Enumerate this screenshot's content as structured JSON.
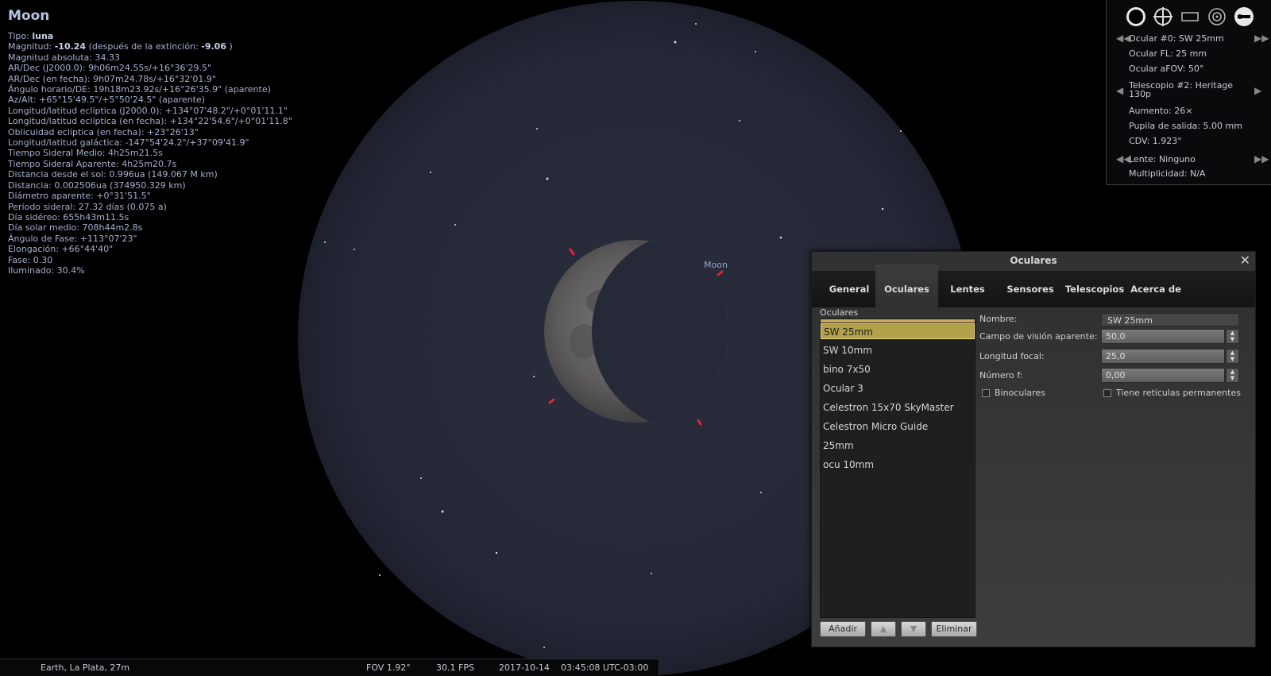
{
  "info": {
    "title": "Moon",
    "lines": {
      "tipo_label": "Tipo: ",
      "tipo_value": "luna",
      "mag_label": "Magnitud: ",
      "mag_value": "-10.24",
      "mag_mid": " (después de la extinción: ",
      "mag_ext": "-9.06",
      "mag_end": " )",
      "l1": "Magnitud absoluta: 34.33",
      "l2": "AR/Dec (J2000.0): 9h06m24.55s/+16°36'29.5\"",
      "l3": "AR/Dec (en fecha): 9h07m24.78s/+16°32'01.9\"",
      "l4": "Ángulo horario/DE: 19h18m23.92s/+16°26'35.9\" (aparente)",
      "l5": "Az/Alt: +65°15'49.5\"/+5°50'24.5\" (aparente)",
      "l6": "Longitud/latitud eclíptica (J2000.0): +134°07'48.2\"/+0°01'11.1\"",
      "l7": "Longitud/latitud eclíptica (en fecha): +134°22'54.6\"/+0°01'11.8\"",
      "l8": "Oblicuidad eclíptica (en fecha): +23°26'13\"",
      "l9": "Longitud/latitud galáctica: -147°54'24.2\"/+37°09'41.9\"",
      "l10": "Tiempo Sideral Medio: 4h25m21.5s",
      "l11": "Tiempo Sideral Aparente: 4h25m20.7s",
      "l12": "Distancia desde el sol: 0.996ua (149.067 M km)",
      "l13": "Distancia: 0.002506ua (374950.329 km)",
      "l14": "Diámetro aparente: +0°31'51.5\"",
      "l15": "Período sideral: 27.32 días (0.075 a)",
      "l16": "Día sidéreo: 655h43m11.5s",
      "l17": "Día solar medio: 708h44m2.8s",
      "l18": "Ángulo de Fase: +113°07'23\"",
      "l19": "Elongación: +66°44'40\"",
      "l20": "Fase: 0.30",
      "l21": "Iluminado: 30.4%"
    }
  },
  "sky": {
    "moon_label": "Moon"
  },
  "ocular_panel": {
    "ocular": "Ocular #0: SW 25mm",
    "ocular_fl": "Ocular FL: 25 mm",
    "ocular_afov": "Ocular aFOV: 50°",
    "telescope_line1": "Telescopio #2: Heritage",
    "telescope_line2": "130p",
    "aumento": "Aumento: 26×",
    "pupila": "Pupila de salida: 5.00 mm",
    "cdv": "CDV: 1.923°",
    "lente": "Lente: Ninguno",
    "multiplicidad": "Multiplicidad: N/A"
  },
  "bottombar": {
    "location": "Earth, La Plata, 27m",
    "fov": "FOV 1.92°",
    "fps": "30.1 FPS",
    "date": "2017-10-14",
    "time": "03:45:08 UTC-03:00"
  },
  "dialog": {
    "title": "Oculares",
    "tabs": [
      "General",
      "Oculares",
      "Lentes",
      "Sensores",
      "Telescopios",
      "Acerca de"
    ],
    "list_label": "Oculares",
    "items": [
      "SW 25mm",
      "SW 10mm",
      "bino 7x50",
      "Ocular 3",
      "Celestron 15x70 SkyMaster",
      "Celestron Micro Guide",
      "25mm",
      "ocu 10mm"
    ],
    "buttons": {
      "add": "Añadir",
      "up": "▲",
      "down": "▼",
      "delete": "Eliminar"
    },
    "form": {
      "nombre_label": "Nombre:",
      "nombre_value": "SW 25mm",
      "afov_label": "Campo de visión aparente:",
      "afov_value": "50,0",
      "focal_label": "Longitud focal:",
      "focal_value": "25,0",
      "f_label": "Número f:",
      "f_value": "0,00",
      "binoculares_label": "Binoculares",
      "reticulas_label": "Tiene retículas permanentes"
    }
  }
}
